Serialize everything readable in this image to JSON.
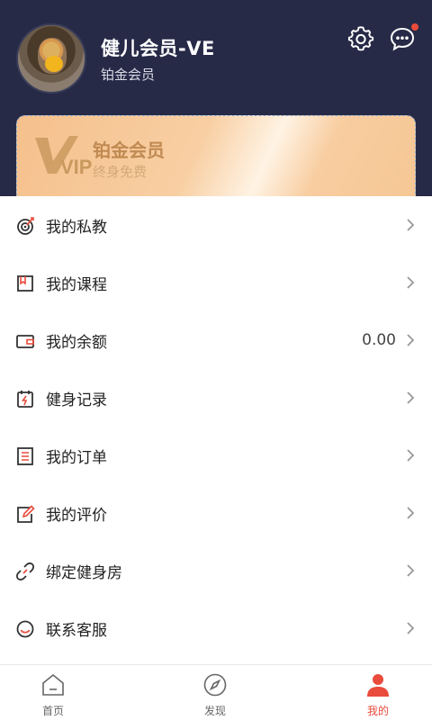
{
  "profile": {
    "username": "健儿会员-VE",
    "member_level": "铂金会员"
  },
  "vip_card": {
    "logo_text": "VIP",
    "title": "铂金会员",
    "subtitle": "终身免费"
  },
  "menu": [
    {
      "label": "我的私教",
      "icon": "target-icon",
      "value": ""
    },
    {
      "label": "我的课程",
      "icon": "bookmark-icon",
      "value": ""
    },
    {
      "label": "我的余额",
      "icon": "wallet-icon",
      "value": "0.00"
    },
    {
      "label": "健身记录",
      "icon": "record-icon",
      "value": ""
    },
    {
      "label": "我的订单",
      "icon": "order-icon",
      "value": ""
    },
    {
      "label": "我的评价",
      "icon": "edit-icon",
      "value": ""
    },
    {
      "label": "绑定健身房",
      "icon": "link-icon",
      "value": ""
    },
    {
      "label": "联系客服",
      "icon": "customer-service-icon",
      "value": ""
    }
  ],
  "tabbar": {
    "home": "首页",
    "discover": "发现",
    "mine": "我的"
  },
  "colors": {
    "header_bg": "#262a47",
    "accent": "#e94b3c",
    "vip_gold": "#c08a52"
  }
}
